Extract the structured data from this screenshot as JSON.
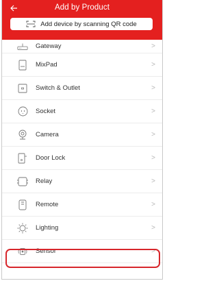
{
  "header": {
    "title": "Add by Product",
    "back_icon": "back-arrow-icon",
    "accent_color": "#e4201f"
  },
  "scan": {
    "label": "Add device by scanning QR code",
    "icon": "qr-scan-icon"
  },
  "list": {
    "items": [
      {
        "label": "Gateway",
        "icon": "gateway-icon"
      },
      {
        "label": "MixPad",
        "icon": "mixpad-icon"
      },
      {
        "label": "Switch & Outlet",
        "icon": "switch-outlet-icon"
      },
      {
        "label": "Socket",
        "icon": "socket-icon"
      },
      {
        "label": "Camera",
        "icon": "camera-icon"
      },
      {
        "label": "Door Lock",
        "icon": "door-lock-icon"
      },
      {
        "label": "Relay",
        "icon": "relay-icon"
      },
      {
        "label": "Remote",
        "icon": "remote-icon"
      },
      {
        "label": "Lighting",
        "icon": "lighting-icon"
      },
      {
        "label": "Sensor",
        "icon": "sensor-icon"
      }
    ],
    "chevron": ">"
  },
  "highlight_color": "#d7262b"
}
